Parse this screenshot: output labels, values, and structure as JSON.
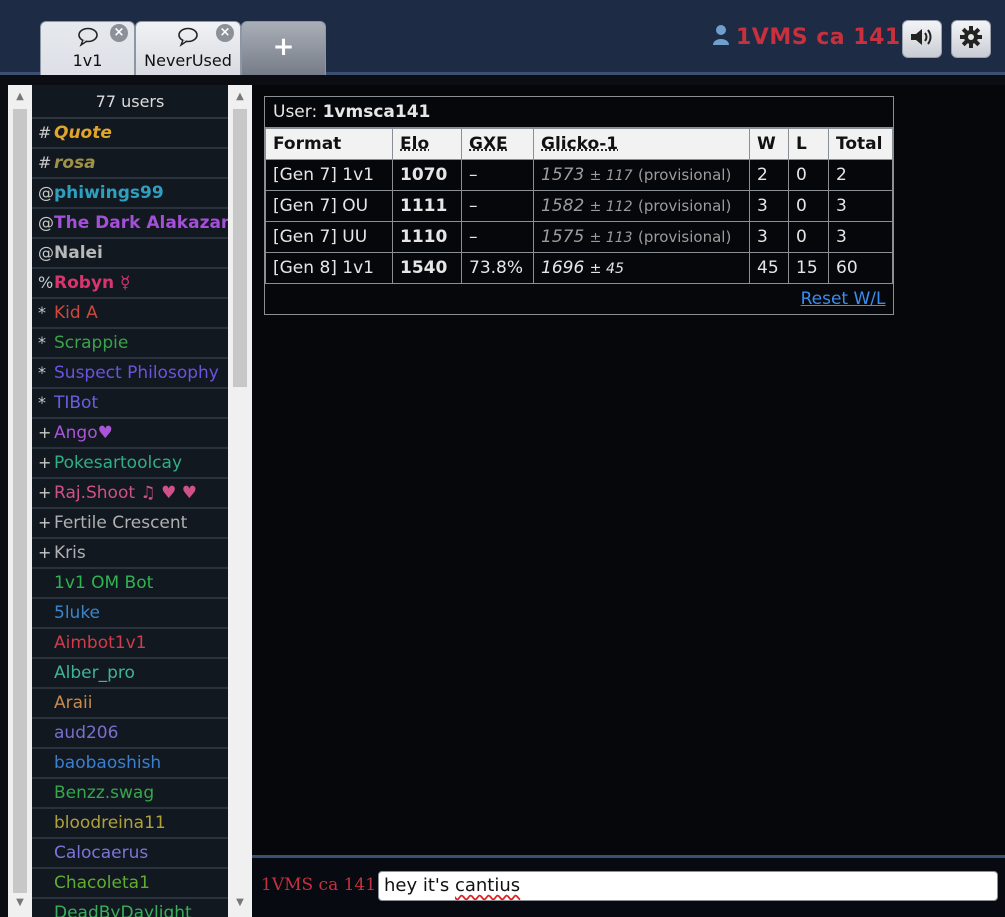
{
  "tabs": [
    {
      "label": "1v1",
      "icon": "speech-bubble-icon",
      "close": "×"
    },
    {
      "label": "NeverUsed",
      "icon": "speech-bubble-icon",
      "close": "×"
    },
    {
      "label": "+"
    }
  ],
  "header": {
    "username": "1VMS ca 141",
    "user_icon": "user-icon",
    "sound_icon": "speaker-icon",
    "settings_icon": "gear-icon"
  },
  "userlist": {
    "count": "77 users",
    "users": [
      {
        "rank": "#",
        "name": "Quote",
        "color": "#e0a52a",
        "style": "bold-italic"
      },
      {
        "rank": "#",
        "name": "rosa",
        "color": "#9e9248",
        "style": "bold-italic"
      },
      {
        "rank": "@",
        "name": "phiwings99",
        "color": "#2f9fc0",
        "style": "bold"
      },
      {
        "rank": "@",
        "name": "The Dark Alakazam",
        "color": "#a34fd6",
        "style": "bold"
      },
      {
        "rank": "@",
        "name": "Nalei",
        "color": "#b8b8b8",
        "style": "bold"
      },
      {
        "rank": "%",
        "name": "Robyn ☿",
        "color": "#d8356f",
        "style": "bold"
      },
      {
        "rank": "*",
        "name": "Kid A",
        "color": "#d0473c",
        "style": "normal"
      },
      {
        "rank": "*",
        "name": "Scrappie",
        "color": "#3aa34a",
        "style": "normal"
      },
      {
        "rank": "*",
        "name": "Suspect Philosophy",
        "color": "#6b53de",
        "style": "normal"
      },
      {
        "rank": "*",
        "name": "TIBot",
        "color": "#6b5fe0",
        "style": "normal"
      },
      {
        "rank": "+",
        "name": "Ango♥",
        "color": "#a855d8",
        "style": "normal"
      },
      {
        "rank": "+",
        "name": "Pokesartoolcay",
        "color": "#2fae88",
        "style": "normal"
      },
      {
        "rank": "+",
        "name": "Raj.Shoot ♫ ♥ ♥",
        "color": "#d0508a",
        "style": "normal"
      },
      {
        "rank": "+",
        "name": "Fertile Crescent",
        "color": "#b0b0b0",
        "style": "normal"
      },
      {
        "rank": "+",
        "name": "Kris",
        "color": "#b0b0b0",
        "style": "normal"
      },
      {
        "rank": "",
        "name": "1v1 OM Bot",
        "color": "#2fb44f",
        "style": "normal"
      },
      {
        "rank": "",
        "name": "5luke",
        "color": "#3a86c9",
        "style": "normal"
      },
      {
        "rank": "",
        "name": "Aimbot1v1",
        "color": "#d23b4a",
        "style": "normal"
      },
      {
        "rank": "",
        "name": "Alber_pro",
        "color": "#3eb39a",
        "style": "normal"
      },
      {
        "rank": "",
        "name": "Araii",
        "color": "#c98a4a",
        "style": "normal"
      },
      {
        "rank": "",
        "name": "aud206",
        "color": "#7b6dd0",
        "style": "normal"
      },
      {
        "rank": "",
        "name": "baobaoshish",
        "color": "#3b7fd0",
        "style": "normal"
      },
      {
        "rank": "",
        "name": "Benzz.swag",
        "color": "#36a84a",
        "style": "normal"
      },
      {
        "rank": "",
        "name": "bloodreina11",
        "color": "#b0a23a",
        "style": "normal"
      },
      {
        "rank": "",
        "name": "Calocaerus",
        "color": "#7a75d8",
        "style": "normal"
      },
      {
        "rank": "",
        "name": "Chacoleta1",
        "color": "#5fae2f",
        "style": "normal"
      },
      {
        "rank": "",
        "name": "DeadByDaylight",
        "color": "#3aae5a",
        "style": "normal"
      }
    ]
  },
  "stats": {
    "user_label": "User:",
    "user_name": "1vmsca141",
    "headers": [
      "Format",
      "Elo",
      "GXE",
      "Glicko-1",
      "W",
      "L",
      "Total"
    ],
    "rows": [
      {
        "format": "[Gen 7] 1v1",
        "elo": "1070",
        "gxe": "–",
        "glicko": "1573",
        "pm": "± 117",
        "prov": "(provisional)",
        "w": "2",
        "l": "0",
        "total": "2"
      },
      {
        "format": "[Gen 7] OU",
        "elo": "1111",
        "gxe": "–",
        "glicko": "1582",
        "pm": "± 112",
        "prov": "(provisional)",
        "w": "3",
        "l": "0",
        "total": "3"
      },
      {
        "format": "[Gen 7] UU",
        "elo": "1110",
        "gxe": "–",
        "glicko": "1575",
        "pm": "± 113",
        "prov": "(provisional)",
        "w": "3",
        "l": "0",
        "total": "3"
      },
      {
        "format": "[Gen 8] 1v1",
        "elo": "1540",
        "gxe": "73.8%",
        "glicko": "1696",
        "pm": "± 45",
        "prov": "",
        "w": "45",
        "l": "15",
        "total": "60"
      }
    ],
    "reset_label": "Reset W/L"
  },
  "chat": {
    "name": "1VMS ca 141",
    "input_value_pre": "hey it's ",
    "input_value_misspelled": "cantius"
  }
}
